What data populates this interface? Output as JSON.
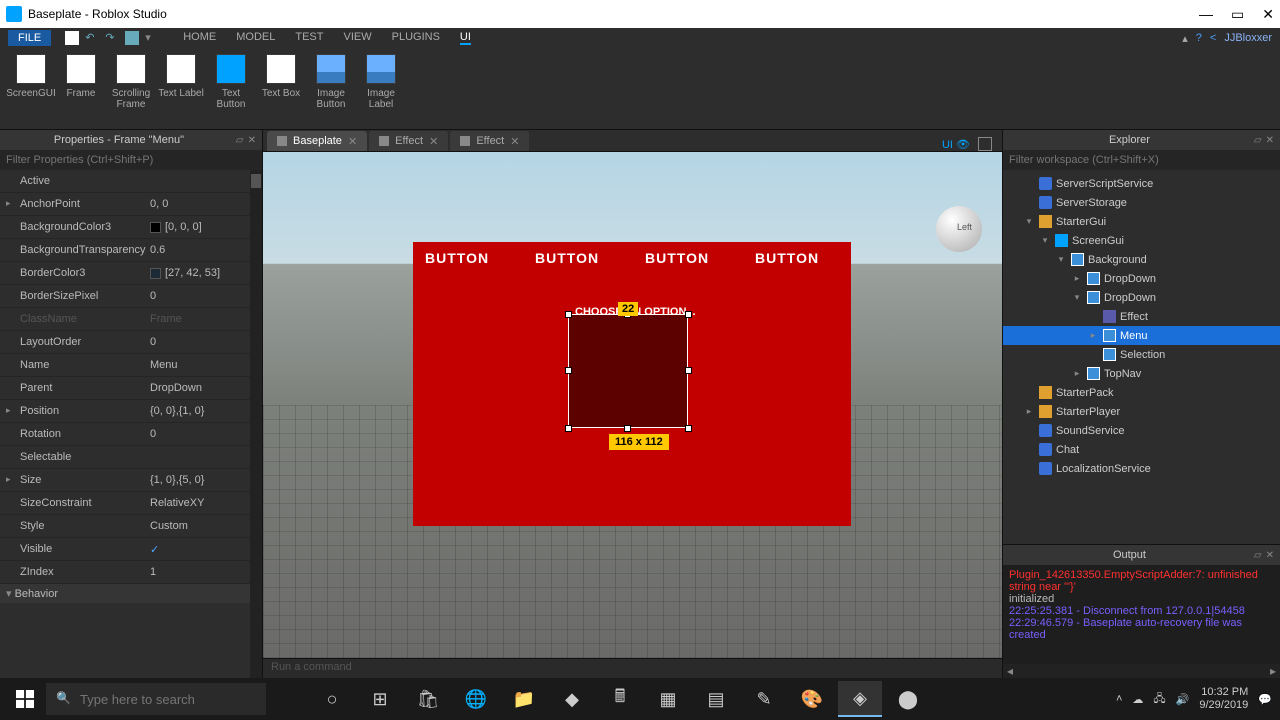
{
  "window": {
    "title": "Baseplate - Roblox Studio"
  },
  "menubar": {
    "file": "FILE",
    "tabs": [
      "HOME",
      "MODEL",
      "TEST",
      "VIEW",
      "PLUGINS",
      "UI"
    ],
    "active": 5,
    "user": "JJBloxxer"
  },
  "ribbon": [
    {
      "label": "ScreenGUI"
    },
    {
      "label": "Frame"
    },
    {
      "label": "Scrolling Frame"
    },
    {
      "label": "Text Label"
    },
    {
      "label": "Text Button",
      "sel": true
    },
    {
      "label": "Text Box"
    },
    {
      "label": "Image Button",
      "img": true
    },
    {
      "label": "Image Label",
      "img": true
    }
  ],
  "properties": {
    "title": "Properties - Frame \"Menu\"",
    "filter": "Filter Properties (Ctrl+Shift+P)",
    "rows": [
      {
        "name": "Active",
        "val": "",
        "check": false
      },
      {
        "name": "AnchorPoint",
        "val": "0, 0",
        "exp": true
      },
      {
        "name": "BackgroundColor3",
        "val": "[0, 0, 0]",
        "swatch": "#000000"
      },
      {
        "name": "BackgroundTransparency",
        "val": "0.6"
      },
      {
        "name": "BorderColor3",
        "val": "[27, 42, 53]",
        "swatch": "#1b2a35"
      },
      {
        "name": "BorderSizePixel",
        "val": "0"
      },
      {
        "name": "ClassName",
        "val": "Frame",
        "dim": true
      },
      {
        "name": "LayoutOrder",
        "val": "0"
      },
      {
        "name": "Name",
        "val": "Menu"
      },
      {
        "name": "Parent",
        "val": "DropDown"
      },
      {
        "name": "Position",
        "val": "{0, 0},{1, 0}",
        "exp": true
      },
      {
        "name": "Rotation",
        "val": "0"
      },
      {
        "name": "Selectable",
        "val": "",
        "check": false
      },
      {
        "name": "Size",
        "val": "{1, 0},{5, 0}",
        "exp": true
      },
      {
        "name": "SizeConstraint",
        "val": "RelativeXY"
      },
      {
        "name": "Style",
        "val": "Custom"
      },
      {
        "name": "Visible",
        "val": "",
        "check": true
      },
      {
        "name": "ZIndex",
        "val": "1"
      }
    ],
    "section": "Behavior"
  },
  "doctabs": {
    "tabs": [
      {
        "label": "Baseplate",
        "active": true
      },
      {
        "label": "Effect"
      },
      {
        "label": "Effect"
      }
    ],
    "ui_indicator": "UI"
  },
  "viewport": {
    "gizmo_label": "Left",
    "buttons": [
      "BUTTON",
      "BUTTON",
      "BUTTON",
      "BUTTON"
    ],
    "choose": "CHOOSE AN OPTION...",
    "tag_top": "22",
    "tag_bottom": "116 x 112"
  },
  "explorer": {
    "title": "Explorer",
    "filter": "Filter workspace (Ctrl+Shift+X)",
    "tree": [
      {
        "indent": 1,
        "arr": "",
        "ico": "svc",
        "label": "ServerScriptService"
      },
      {
        "indent": 1,
        "arr": "",
        "ico": "svc",
        "label": "ServerStorage"
      },
      {
        "indent": 1,
        "arr": "▾",
        "ico": "folder",
        "label": "StarterGui"
      },
      {
        "indent": 2,
        "arr": "▾",
        "ico": "gui",
        "label": "ScreenGui"
      },
      {
        "indent": 3,
        "arr": "▾",
        "ico": "frame",
        "label": "Background"
      },
      {
        "indent": 4,
        "arr": "▸",
        "ico": "frame",
        "label": "DropDown"
      },
      {
        "indent": 4,
        "arr": "▾",
        "ico": "frame",
        "label": "DropDown"
      },
      {
        "indent": 5,
        "arr": "",
        "ico": "script",
        "label": "Effect"
      },
      {
        "indent": 5,
        "arr": "▸",
        "ico": "frame",
        "label": "Menu",
        "sel": true
      },
      {
        "indent": 5,
        "arr": "",
        "ico": "frame",
        "label": "Selection"
      },
      {
        "indent": 4,
        "arr": "▸",
        "ico": "frame",
        "label": "TopNav"
      },
      {
        "indent": 1,
        "arr": "",
        "ico": "folder",
        "label": "StarterPack"
      },
      {
        "indent": 1,
        "arr": "▸",
        "ico": "folder",
        "label": "StarterPlayer"
      },
      {
        "indent": 1,
        "arr": "",
        "ico": "svc",
        "label": "SoundService"
      },
      {
        "indent": 1,
        "arr": "",
        "ico": "svc",
        "label": "Chat"
      },
      {
        "indent": 1,
        "arr": "",
        "ico": "svc",
        "label": "LocalizationService"
      }
    ]
  },
  "output": {
    "title": "Output",
    "lines": [
      {
        "cls": "err",
        "text": "Plugin_142613350.EmptyScriptAdder:7: unfinished string near '\"}'"
      },
      {
        "cls": "info",
        "text": "initialized"
      },
      {
        "cls": "log",
        "text": "22:25:25.381 - Disconnect from 127.0.0.1|54458"
      },
      {
        "cls": "log",
        "text": "22:29:46.579 - Baseplate auto-recovery file was created"
      }
    ]
  },
  "cmdbar": "Run a command",
  "taskbar": {
    "search": "Type here to search",
    "time": "10:32 PM",
    "date": "9/29/2019"
  }
}
